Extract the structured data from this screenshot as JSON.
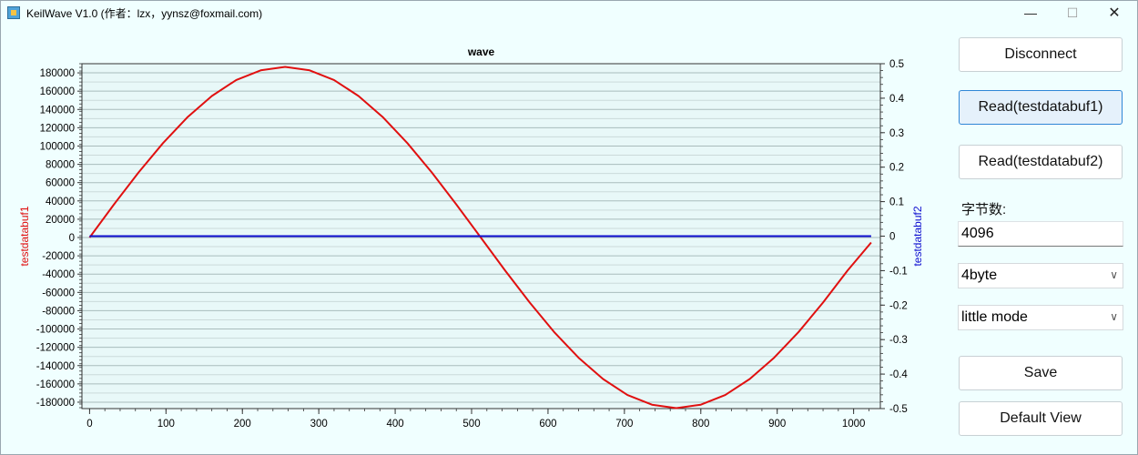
{
  "window": {
    "title": "KeilWave V1.0 (作者：lzx，yynsz@foxmail.com)",
    "min_icon": "minimize-icon",
    "max_icon": "maximize-icon",
    "close_icon": "close-icon"
  },
  "controls": {
    "disconnect_label": "Disconnect",
    "read1_label": "Read(testdatabuf1)",
    "read2_label": "Read(testdatabuf2)",
    "bytes_label": "字节数:",
    "bytes_value": "4096",
    "type_select": "4byte",
    "mode_select": "little mode",
    "save_label": "Save",
    "default_view_label": "Default View"
  },
  "chart_data": {
    "type": "line",
    "title": "wave",
    "xlabel": "",
    "ylabel": "testdatabuf1",
    "y2label": "testdatabuf2",
    "xlim": [
      -10,
      1035
    ],
    "ylim": [
      -187000,
      190000
    ],
    "y2lim": [
      -0.5,
      0.5
    ],
    "x_ticks": [
      0,
      100,
      200,
      300,
      400,
      500,
      600,
      700,
      800,
      900,
      1000
    ],
    "y_ticks": [
      -180000,
      -160000,
      -140000,
      -120000,
      -100000,
      -80000,
      -60000,
      -40000,
      -20000,
      0,
      20000,
      40000,
      60000,
      80000,
      100000,
      120000,
      140000,
      160000,
      180000
    ],
    "y2_ticks": [
      -0.5,
      -0.4,
      -0.3,
      -0.2,
      -0.1,
      0,
      0.1,
      0.2,
      0.3,
      0.4,
      0.5
    ],
    "grid": true,
    "series": [
      {
        "name": "testdatabuf1",
        "color": "#e01010",
        "axis": "left",
        "x": [
          0,
          32,
          64,
          96,
          128,
          160,
          192,
          224,
          256,
          288,
          320,
          352,
          384,
          416,
          448,
          480,
          512,
          544,
          576,
          608,
          640,
          672,
          704,
          736,
          768,
          800,
          832,
          864,
          896,
          928,
          960,
          992,
          1023
        ],
        "y": [
          0,
          36200,
          71000,
          103200,
          131400,
          154700,
          172200,
          182700,
          186500,
          182700,
          172200,
          154700,
          131400,
          103200,
          71000,
          36200,
          0,
          -36200,
          -71000,
          -103200,
          -131400,
          -154700,
          -172200,
          -182700,
          -186500,
          -182700,
          -172200,
          -154700,
          -131400,
          -103200,
          -71000,
          -36200,
          -5500
        ]
      },
      {
        "name": "testdatabuf2",
        "color": "#1010d0",
        "axis": "right",
        "x": [
          0,
          1023
        ],
        "y": [
          0,
          0
        ]
      }
    ]
  }
}
